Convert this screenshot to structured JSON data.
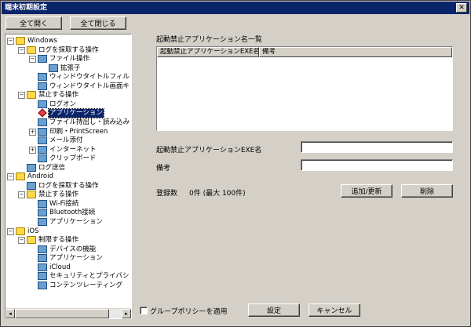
{
  "window": {
    "title": "端末初期設定",
    "close_glyph": "✕"
  },
  "toolbar": {
    "expand_all": "全て開く",
    "collapse_all": "全て閉じる"
  },
  "tree": [
    {
      "label": "Windows",
      "icon": "folder-icon",
      "expander": "−"
    },
    {
      "label": "ログを採取する操作",
      "icon": "folder-icon",
      "expander": "−"
    },
    {
      "label": "ファイル操作",
      "icon": "computer-icon",
      "expander": "−"
    },
    {
      "label": "拡張子",
      "icon": "computer-icon",
      "expander": ""
    },
    {
      "label": "ウィンドウタイトルフィルタ",
      "icon": "computer-icon",
      "expander": ""
    },
    {
      "label": "ウィンドウタイトル画面キャ",
      "icon": "computer-icon",
      "expander": ""
    },
    {
      "label": "禁止する操作",
      "icon": "folder-icon",
      "expander": "−"
    },
    {
      "label": "ログオン",
      "icon": "computer-icon",
      "expander": ""
    },
    {
      "label": "アプリケーション",
      "icon": "diamond-icon",
      "expander": ""
    },
    {
      "label": "ファイル持出し・読み込み",
      "icon": "computer-icon",
      "expander": ""
    },
    {
      "label": "印刷・PrintScreen",
      "icon": "computer-icon",
      "expander": "+"
    },
    {
      "label": "メール添付",
      "icon": "computer-icon",
      "expander": ""
    },
    {
      "label": "インターネット",
      "icon": "computer-icon",
      "expander": "+"
    },
    {
      "label": "クリップボード",
      "icon": "computer-icon",
      "expander": ""
    },
    {
      "label": "ログ送信",
      "icon": "computer-icon",
      "expander": ""
    },
    {
      "label": "Android",
      "icon": "folder-icon",
      "expander": "−"
    },
    {
      "label": "ログを採取する操作",
      "icon": "computer-icon",
      "expander": ""
    },
    {
      "label": "禁止する操作",
      "icon": "folder-icon",
      "expander": "−"
    },
    {
      "label": "Wi-Fi接続",
      "icon": "computer-icon",
      "expander": ""
    },
    {
      "label": "Bluetooth接続",
      "icon": "computer-icon",
      "expander": ""
    },
    {
      "label": "アプリケーション",
      "icon": "computer-icon",
      "expander": ""
    },
    {
      "label": "iOS",
      "icon": "folder-icon",
      "expander": "−"
    },
    {
      "label": "制限する操作",
      "icon": "folder-icon",
      "expander": "−"
    },
    {
      "label": "デバイスの機能",
      "icon": "computer-icon",
      "expander": ""
    },
    {
      "label": "アプリケーション",
      "icon": "computer-icon",
      "expander": ""
    },
    {
      "label": "iCloud",
      "icon": "computer-icon",
      "expander": ""
    },
    {
      "label": "セキュリティとプライバシー",
      "icon": "computer-icon",
      "expander": ""
    },
    {
      "label": "コンテンツレーティング",
      "icon": "computer-icon",
      "expander": ""
    }
  ],
  "scroll": {
    "left_glyph": "◂",
    "right_glyph": "▸"
  },
  "main": {
    "list_title": "起動禁止アプリケーション名一覧",
    "columns": [
      "起動禁止アプリケーションEXE名",
      "備考"
    ],
    "exe_label": "起動禁止アプリケーションEXE名",
    "exe_value": "",
    "note_label": "備考",
    "note_value": "",
    "count_label": "登録数",
    "count_value": "0件 (最大 100件)",
    "add_update": "追加/更新",
    "delete": "削除"
  },
  "footer": {
    "group_policy": "グループポリシーを適用",
    "set": "設定",
    "cancel": "キャンセル"
  }
}
